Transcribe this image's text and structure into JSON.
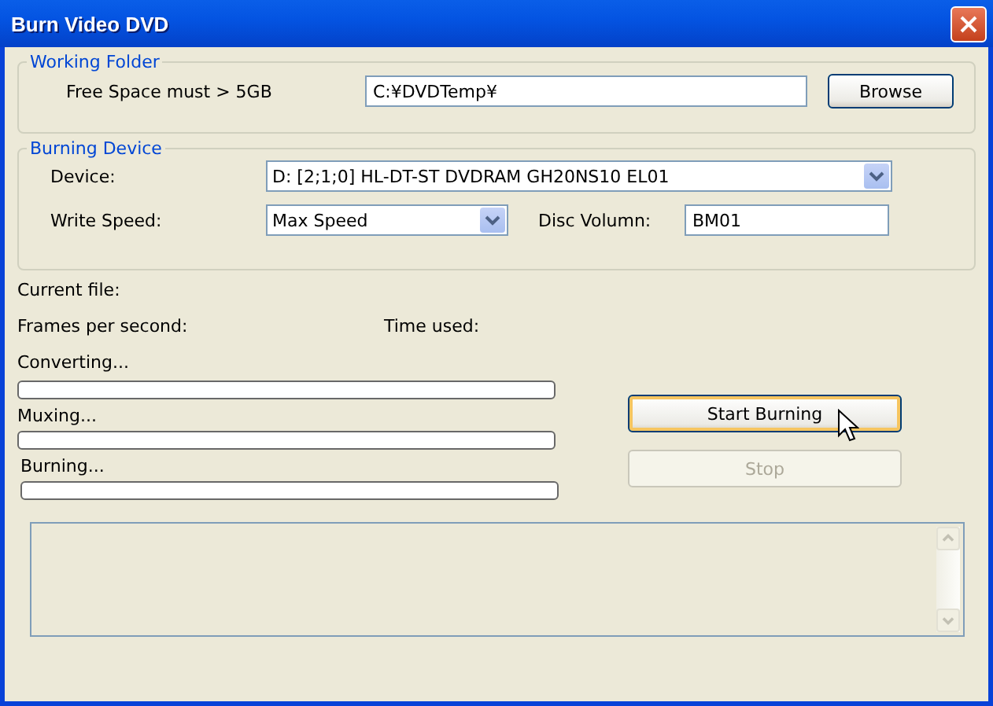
{
  "window": {
    "title": "Burn Video DVD"
  },
  "working_folder": {
    "legend": "Working Folder",
    "label": "Free Space must > 5GB",
    "path": "C:¥DVDTemp¥",
    "browse_button": "Browse"
  },
  "burning_device": {
    "legend": "Burning Device",
    "device_label": "Device:",
    "device": "D: [2;1;0] HL-DT-ST DVDRAM GH20NS10  EL01",
    "speed_label": "Write Speed:",
    "speed": "Max Speed",
    "volume_label": "Disc Volumn:",
    "volume": "BM01"
  },
  "status": {
    "current_file": "Current file:",
    "fps": "Frames per second:",
    "time_used": "Time used:"
  },
  "progress": [
    {
      "label": "Converting...",
      "level": 0
    },
    {
      "label": "Muxing...",
      "level": 0
    },
    {
      "label": "Burning...",
      "level": 0
    }
  ],
  "buttons": [
    {
      "label": "Start Burning",
      "disabled": false
    },
    {
      "label": "Stop",
      "disabled": true
    }
  ],
  "log": {
    "kind": "empty"
  }
}
